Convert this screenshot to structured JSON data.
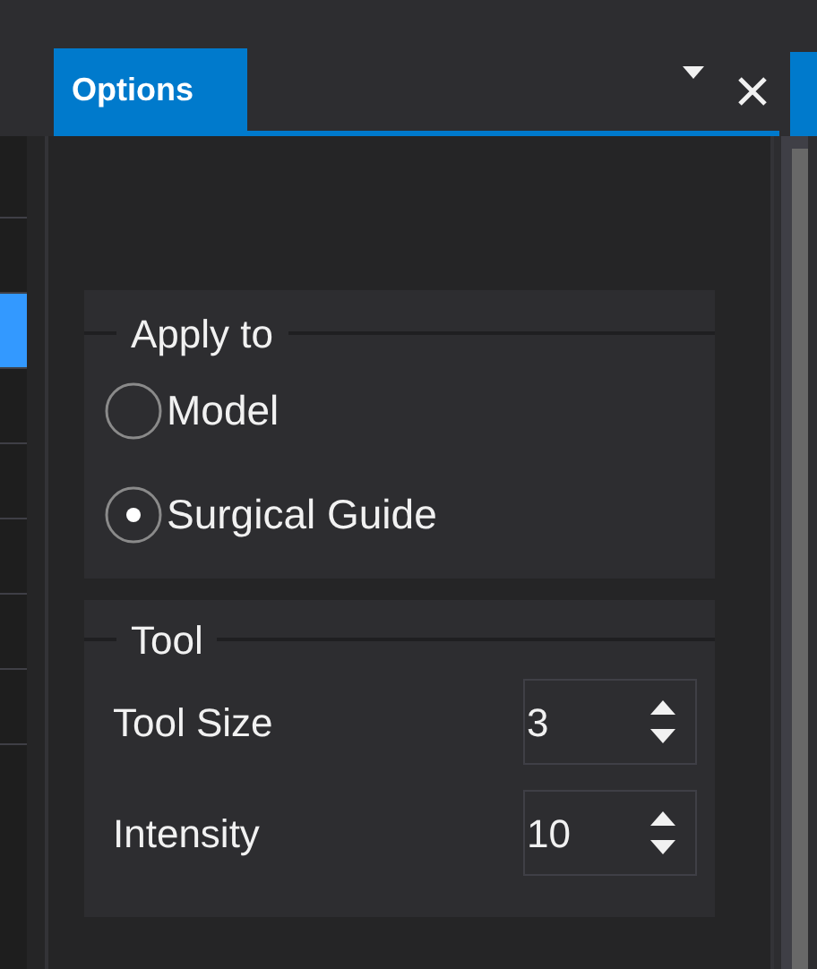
{
  "tab": {
    "label": "Options",
    "selected": true
  },
  "left_panel": {
    "rows": [
      {
        "selected": false
      },
      {
        "selected": false
      },
      {
        "selected": true
      },
      {
        "selected": false
      },
      {
        "selected": false
      },
      {
        "selected": false
      },
      {
        "selected": false
      },
      {
        "selected": false
      }
    ]
  },
  "apply_to": {
    "title": "Apply to",
    "options": [
      {
        "label": "Model",
        "selected": false
      },
      {
        "label": "Surgical Guide",
        "selected": true
      }
    ]
  },
  "tool": {
    "title": "Tool",
    "fields": [
      {
        "label": "Tool Size",
        "value": "3"
      },
      {
        "label": "Intensity",
        "value": "10"
      }
    ]
  }
}
